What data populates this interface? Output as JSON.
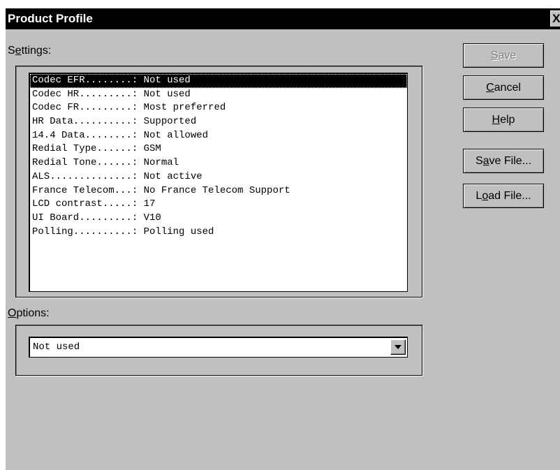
{
  "window": {
    "title": "Product Profile",
    "close_glyph": "X"
  },
  "settings_group": {
    "label_pre": "S",
    "label_mnemonic": "e",
    "label_post": "ttings:"
  },
  "settings_list": [
    {
      "text": "Codec EFR........: Not used",
      "selected": true
    },
    {
      "text": "Codec HR.........: Not used",
      "selected": false
    },
    {
      "text": "Codec FR.........: Most preferred",
      "selected": false
    },
    {
      "text": "HR Data..........: Supported",
      "selected": false
    },
    {
      "text": "14.4 Data........: Not allowed",
      "selected": false
    },
    {
      "text": "Redial Type......: GSM",
      "selected": false
    },
    {
      "text": "Redial Tone......: Normal",
      "selected": false
    },
    {
      "text": "ALS..............: Not active",
      "selected": false
    },
    {
      "text": "France Telecom...: No France Telecom Support",
      "selected": false
    },
    {
      "text": "LCD contrast.....: 17",
      "selected": false
    },
    {
      "text": "UI Board.........: V10",
      "selected": false
    },
    {
      "text": "Polling..........: Polling used",
      "selected": false
    }
  ],
  "options_group": {
    "label_mnemonic": "O",
    "label_post": "ptions:",
    "selected_value": "Not used"
  },
  "buttons": {
    "save": {
      "pre": "",
      "mnemonic": "S",
      "post": "ave",
      "enabled": false
    },
    "cancel": {
      "pre": "",
      "mnemonic": "C",
      "post": "ancel",
      "enabled": true
    },
    "help": {
      "pre": "",
      "mnemonic": "H",
      "post": "elp",
      "enabled": true
    },
    "save_file": {
      "pre": "S",
      "mnemonic": "a",
      "post": "ve File...",
      "enabled": true
    },
    "load_file": {
      "pre": "L",
      "mnemonic": "o",
      "post": "ad File...",
      "enabled": true
    }
  },
  "colors": {
    "face": "#c0c0c0",
    "titlebar": "#000000",
    "selection": "#000000",
    "disabled_text": "#808080"
  }
}
